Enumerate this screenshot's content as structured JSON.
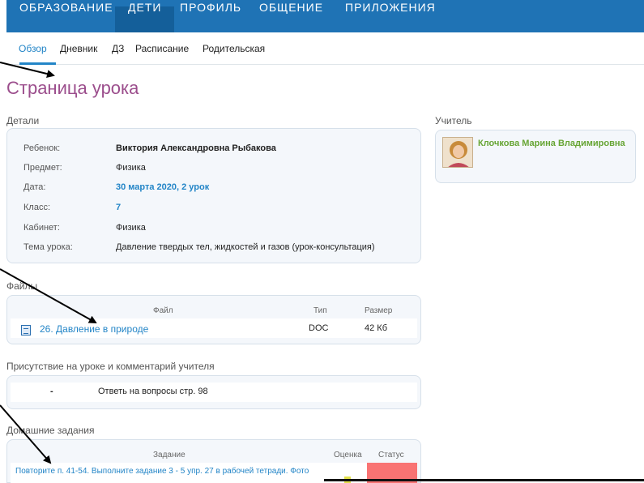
{
  "top_nav": {
    "tabs": [
      {
        "label": "ОБРАЗОВАНИЕ",
        "active": false
      },
      {
        "label": "ДЕТИ",
        "active": true
      },
      {
        "label": "ПРОФИЛЬ",
        "active": false
      },
      {
        "label": "ОБЩЕНИЕ",
        "active": false
      },
      {
        "label": "ПРИЛОЖЕНИЯ",
        "active": false
      }
    ]
  },
  "sub_nav": {
    "items": [
      "Обзор",
      "Дневник",
      "ДЗ",
      "Расписание",
      "Родительская"
    ],
    "active": "Обзор"
  },
  "page_title": "Страница урока",
  "details": {
    "title": "Детали",
    "rows": [
      {
        "label": "Ребенок:",
        "value": "Виктория Александровна Рыбакова"
      },
      {
        "label": "Предмет:",
        "value": "Физика"
      },
      {
        "label": "Дата:",
        "value": "30 марта 2020, 2 урок"
      },
      {
        "label": "Класс:",
        "value": "7"
      },
      {
        "label": "Кабинет:",
        "value": "Физика"
      },
      {
        "label": "Тема урока:",
        "value": "Давление твердых тел, жидкостей и газов (урок-консультация)"
      }
    ]
  },
  "teacher": {
    "title": "Учитель",
    "name": "Клочкова Марина Владимировна"
  },
  "files": {
    "title": "Файлы",
    "columns": {
      "file": "Файл",
      "type": "Тип",
      "size": "Размер"
    },
    "rows": [
      {
        "name": "26. Давление в природе",
        "type": "DOC",
        "size": "42 Кб"
      }
    ]
  },
  "attendance": {
    "title": "Присутствие на уроке и комментарий учителя",
    "mark": "-",
    "comment": "Ответь на вопросы стр. 98"
  },
  "homework": {
    "title": "Домашние задания",
    "columns": {
      "task": "Задание",
      "grade": "Оценка",
      "status": "Статус"
    },
    "rows": [
      {
        "task": "Повторите п. 41-54. Выполните задание 3 - 5 упр. 27 в рабочей тетради. Фото"
      }
    ]
  },
  "colors": {
    "nav_bg": "#1f73b5",
    "title": "#9b4d8c",
    "link": "#2385c7",
    "teacher_name": "#67a534",
    "status_red": "#f97373"
  }
}
